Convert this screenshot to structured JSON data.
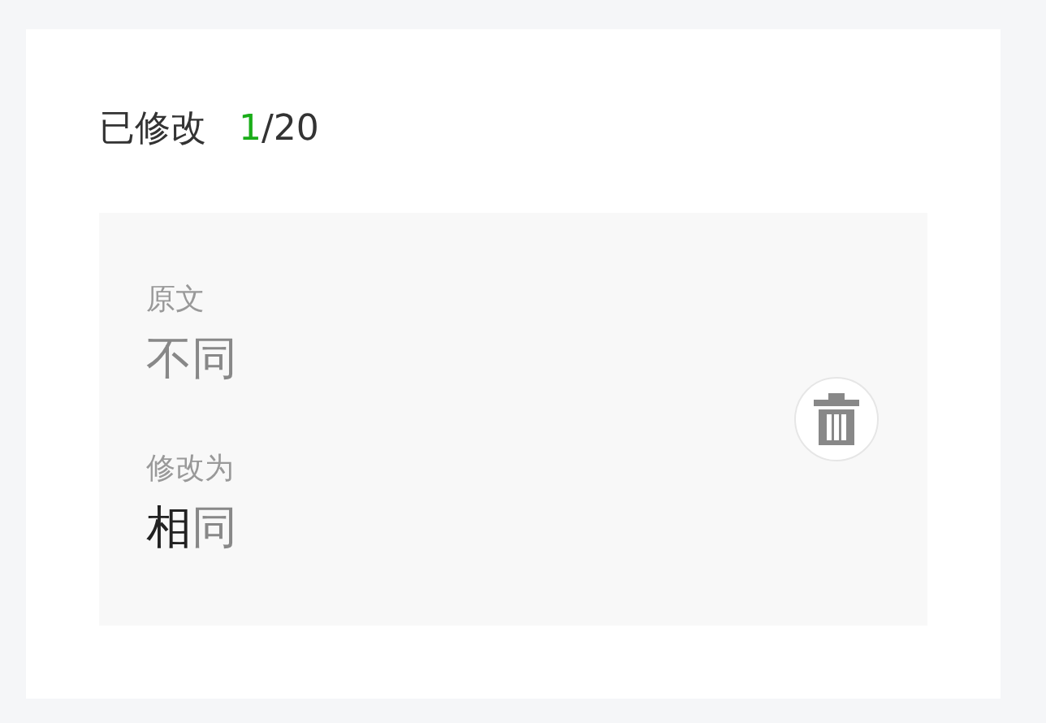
{
  "header": {
    "label": "已修改",
    "count": "1",
    "total": "/20"
  },
  "change": {
    "original_label": "原文",
    "original_text": "不同",
    "modified_label": "修改为",
    "modified_segments": [
      {
        "text": "相",
        "changed": true
      },
      {
        "text": "同",
        "changed": false
      }
    ]
  }
}
